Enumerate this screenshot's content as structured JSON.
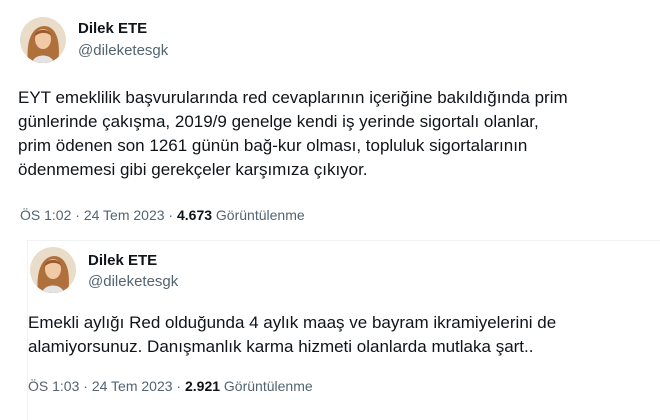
{
  "tweets": [
    {
      "author": {
        "name": "Dilek ETE",
        "handle": "@dileketesgk"
      },
      "lines": [
        "EYT emeklilik başvurularında red cevaplarının içeriğine bakıldığında prim",
        "günlerinde çakışma, 2019/9 genelge kendi iş yerinde sigortalı olanlar,",
        "prim ödenen son 1261 günün bağ-kur olması, topluluk sigortalarının",
        "ödenmemesi gibi gerekçeler karşımıza çıkıyor."
      ],
      "time": "ÖS 1:02",
      "separator": "·",
      "date": "24 Tem 2023",
      "views_count": "4.673",
      "views_label": "Görüntülenme"
    },
    {
      "author": {
        "name": "Dilek ETE",
        "handle": "@dileketesgk"
      },
      "lines": [
        "Emekli aylığı Red olduğunda 4 aylık maaş ve bayram ikramiyelerini de",
        "alamiyorsunuz. Danışmanlık karma hizmeti olanlarda mutlaka şart.."
      ],
      "time": "ÖS 1:03",
      "separator": "·",
      "date": "24 Tem 2023",
      "views_count": "2.921",
      "views_label": "Görüntülenme"
    }
  ]
}
